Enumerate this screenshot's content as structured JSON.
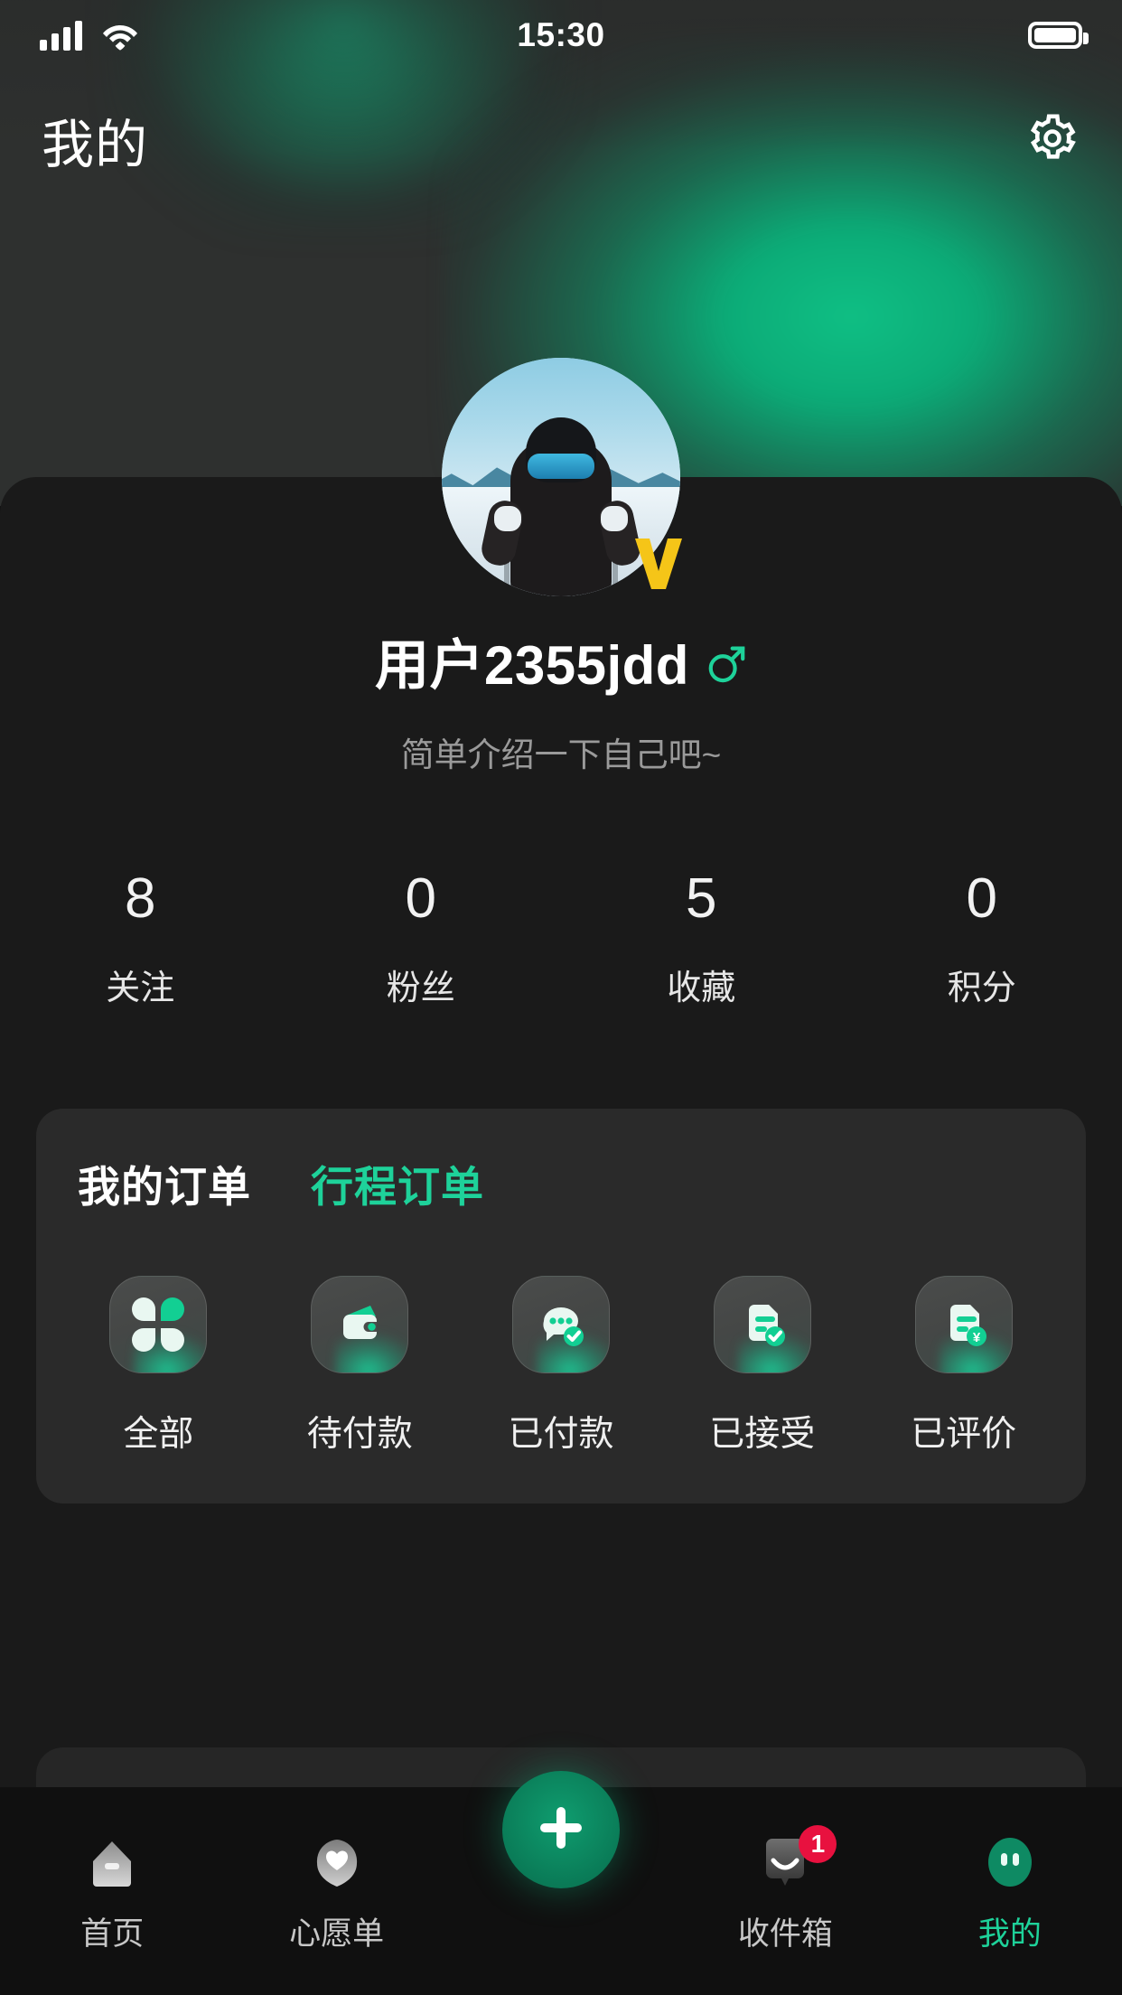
{
  "status_bar": {
    "time": "15:30",
    "signal_icon": "cellular-signal-icon",
    "wifi_icon": "wifi-icon",
    "battery_icon": "battery-full-icon"
  },
  "header": {
    "title": "我的",
    "settings_icon": "gear-icon",
    "accent_green": "#1ed29a",
    "glow_green": "#0fbf84",
    "bg_dark": "#2e302f"
  },
  "profile": {
    "avatar_icon": "user-avatar-skier",
    "verified_badge_icon": "v-verified-badge-icon",
    "verified_badge_color": "#f5c518",
    "username": "用户2355jdd",
    "gender_icon": "male-gender-icon",
    "gender_color": "#1ed29a",
    "bio_placeholder": "简单介绍一下自己吧~",
    "stats": [
      {
        "value": "8",
        "label": "关注"
      },
      {
        "value": "0",
        "label": "粉丝"
      },
      {
        "value": "5",
        "label": "收藏"
      },
      {
        "value": "0",
        "label": "积分"
      }
    ]
  },
  "orders_card": {
    "tabs": [
      {
        "label": "我的订单",
        "active": true
      },
      {
        "label": "行程订单",
        "active": false
      }
    ],
    "items": [
      {
        "label": "全部",
        "icon": "four-petal-grid-icon"
      },
      {
        "label": "待付款",
        "icon": "wallet-icon"
      },
      {
        "label": "已付款",
        "icon": "chat-bubble-check-icon"
      },
      {
        "label": "已接受",
        "icon": "document-check-icon"
      },
      {
        "label": "已评价",
        "icon": "document-yuan-icon"
      }
    ]
  },
  "tabbar": {
    "items": [
      {
        "label": "首页",
        "icon": "home-icon",
        "active": false,
        "badge": ""
      },
      {
        "label": "心愿单",
        "icon": "heart-icon",
        "active": false,
        "badge": ""
      },
      {
        "label": "收件箱",
        "icon": "inbox-icon",
        "active": false,
        "badge": "1"
      },
      {
        "label": "我的",
        "icon": "profile-face-icon",
        "active": true,
        "badge": ""
      }
    ],
    "fab_icon": "plus-icon",
    "fab_color": "#0a7b57",
    "badge_color": "#e8113f"
  }
}
